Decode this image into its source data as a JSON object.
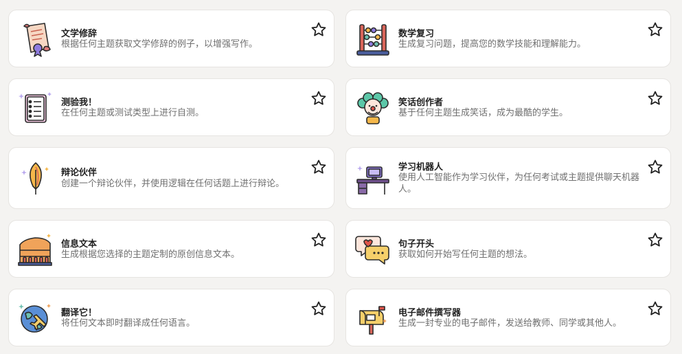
{
  "cards": [
    {
      "title": "文学修辞",
      "description": "根据任何主题获取文学修辞的例子，以增强写作。",
      "icon": "scroll-icon"
    },
    {
      "title": "数学复习",
      "description": "生成复习问题，提高您的数学技能和理解能力。",
      "icon": "abacus-icon"
    },
    {
      "title": "测验我！",
      "description": "在任何主题或测试类型上进行自测。",
      "icon": "checklist-icon"
    },
    {
      "title": "笑话创作者",
      "description": "基于任何主题生成笑话，成为最酷的学生。",
      "icon": "clown-icon"
    },
    {
      "title": "辩论伙伴",
      "description": "创建一个辩论伙伴，并使用逻辑在任何话题上进行辩论。",
      "icon": "quill-icon"
    },
    {
      "title": "学习机器人",
      "description": "使用人工智能作为学习伙伴，为任何考试或主题提供聊天机器人。",
      "icon": "desk-computer-icon"
    },
    {
      "title": "信息文本",
      "description": "生成根据您选择的主题定制的原创信息文本。",
      "icon": "colosseum-icon"
    },
    {
      "title": "句子开头",
      "description": "获取如何开始写任何主题的想法。",
      "icon": "chat-bubbles-icon"
    },
    {
      "title": "翻译它！",
      "description": "将任何文本即时翻译成任何语言。",
      "icon": "globe-plane-icon"
    },
    {
      "title": "电子邮件撰写器",
      "description": "生成一封专业的电子邮件，发送给教师、同学或其他人。",
      "icon": "mailbox-icon"
    }
  ],
  "favorite_icon": "star-outline-icon",
  "colors": {
    "background": "#f4f3f1",
    "card": "#ffffff",
    "title": "#1f1f1f",
    "description": "#6f6f6f"
  }
}
